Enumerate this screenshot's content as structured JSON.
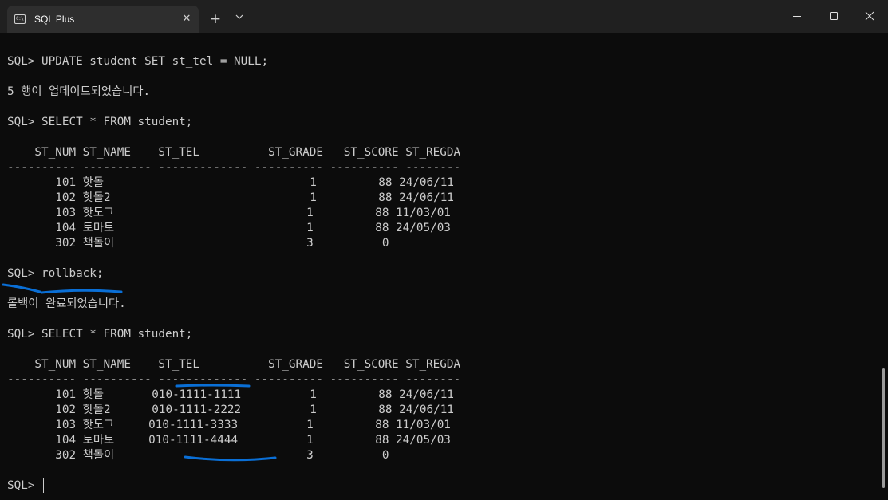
{
  "window": {
    "tab_title": "SQL Plus",
    "tab_icon_text": "C:\\",
    "tab_close": "✕",
    "new_tab": "+"
  },
  "terminal": {
    "lines": [
      "",
      "SQL> UPDATE student SET st_tel = NULL;",
      "",
      "5 행이 업데이트되었습니다.",
      "",
      "SQL> SELECT * FROM student;",
      "",
      "    ST_NUM ST_NAME    ST_TEL          ST_GRADE   ST_SCORE ST_REGDA",
      "---------- ---------- ------------- ---------- ---------- --------",
      "       101 핫돌                              1         88 24/06/11",
      "       102 핫돌2                             1         88 24/06/11",
      "       103 핫도그                            1         88 11/03/01",
      "       104 토마토                            1         88 24/05/03",
      "       302 책돌이                            3          0",
      "",
      "SQL> rollback;",
      "",
      "롤백이 완료되었습니다.",
      "",
      "SQL> SELECT * FROM student;",
      "",
      "    ST_NUM ST_NAME    ST_TEL          ST_GRADE   ST_SCORE ST_REGDA",
      "---------- ---------- ------------- ---------- ---------- --------",
      "       101 핫돌       010-1111-1111          1         88 24/06/11",
      "       102 핫돌2      010-1111-2222          1         88 24/06/11",
      "       103 핫도그     010-1111-3333          1         88 11/03/01",
      "       104 토마토     010-1111-4444          1         88 24/05/03",
      "       302 책돌이                            3          0",
      "",
      "SQL> "
    ]
  },
  "colors": {
    "background": "#0c0c0c",
    "titlebar": "#202020",
    "tab": "#2e2e2e",
    "text": "#cccccc",
    "annotation": "#0a6fd6"
  }
}
